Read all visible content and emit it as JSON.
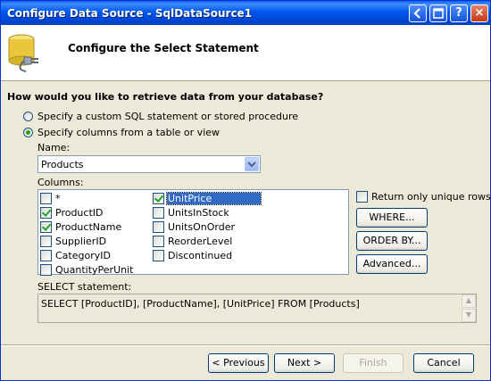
{
  "window": {
    "title": "Configure Data Source - SqlDataSource1",
    "help_label": "?",
    "close_label": "×"
  },
  "header": {
    "title": "Configure the Select Statement",
    "icon": "database-connector-icon"
  },
  "question": "How would you like to retrieve data from your database?",
  "options": {
    "custom_sql": "Specify a custom SQL statement or stored procedure",
    "from_table": "Specify columns from a table or view",
    "selected": "from_table"
  },
  "name": {
    "label": "Name:",
    "value": "Products"
  },
  "columns": {
    "label": "Columns:",
    "items": [
      {
        "label": "*",
        "checked": false
      },
      {
        "label": "ProductID",
        "checked": true
      },
      {
        "label": "ProductName",
        "checked": true
      },
      {
        "label": "SupplierID",
        "checked": false
      },
      {
        "label": "CategoryID",
        "checked": false
      },
      {
        "label": "QuantityPerUnit",
        "checked": false
      },
      {
        "label": "UnitPrice",
        "checked": true,
        "selected": true
      },
      {
        "label": "UnitsInStock",
        "checked": false
      },
      {
        "label": "UnitsOnOrder",
        "checked": false
      },
      {
        "label": "ReorderLevel",
        "checked": false
      },
      {
        "label": "Discontinued",
        "checked": false
      }
    ]
  },
  "unique_rows": {
    "label": "Return only unique rows",
    "checked": false
  },
  "side_buttons": {
    "where": "WHERE...",
    "order_by": "ORDER BY...",
    "advanced": "Advanced..."
  },
  "select_statement": {
    "label": "SELECT statement:",
    "value": "SELECT [ProductID], [ProductName], [UnitPrice] FROM [Products]"
  },
  "footer": {
    "previous": "< Previous",
    "next": "Next >",
    "finish": "Finish",
    "cancel": "Cancel"
  },
  "colors": {
    "titlebar": "#0058ee",
    "dialog_bg": "#ece9d8",
    "selection": "#316ac5",
    "check": "#21a121"
  }
}
